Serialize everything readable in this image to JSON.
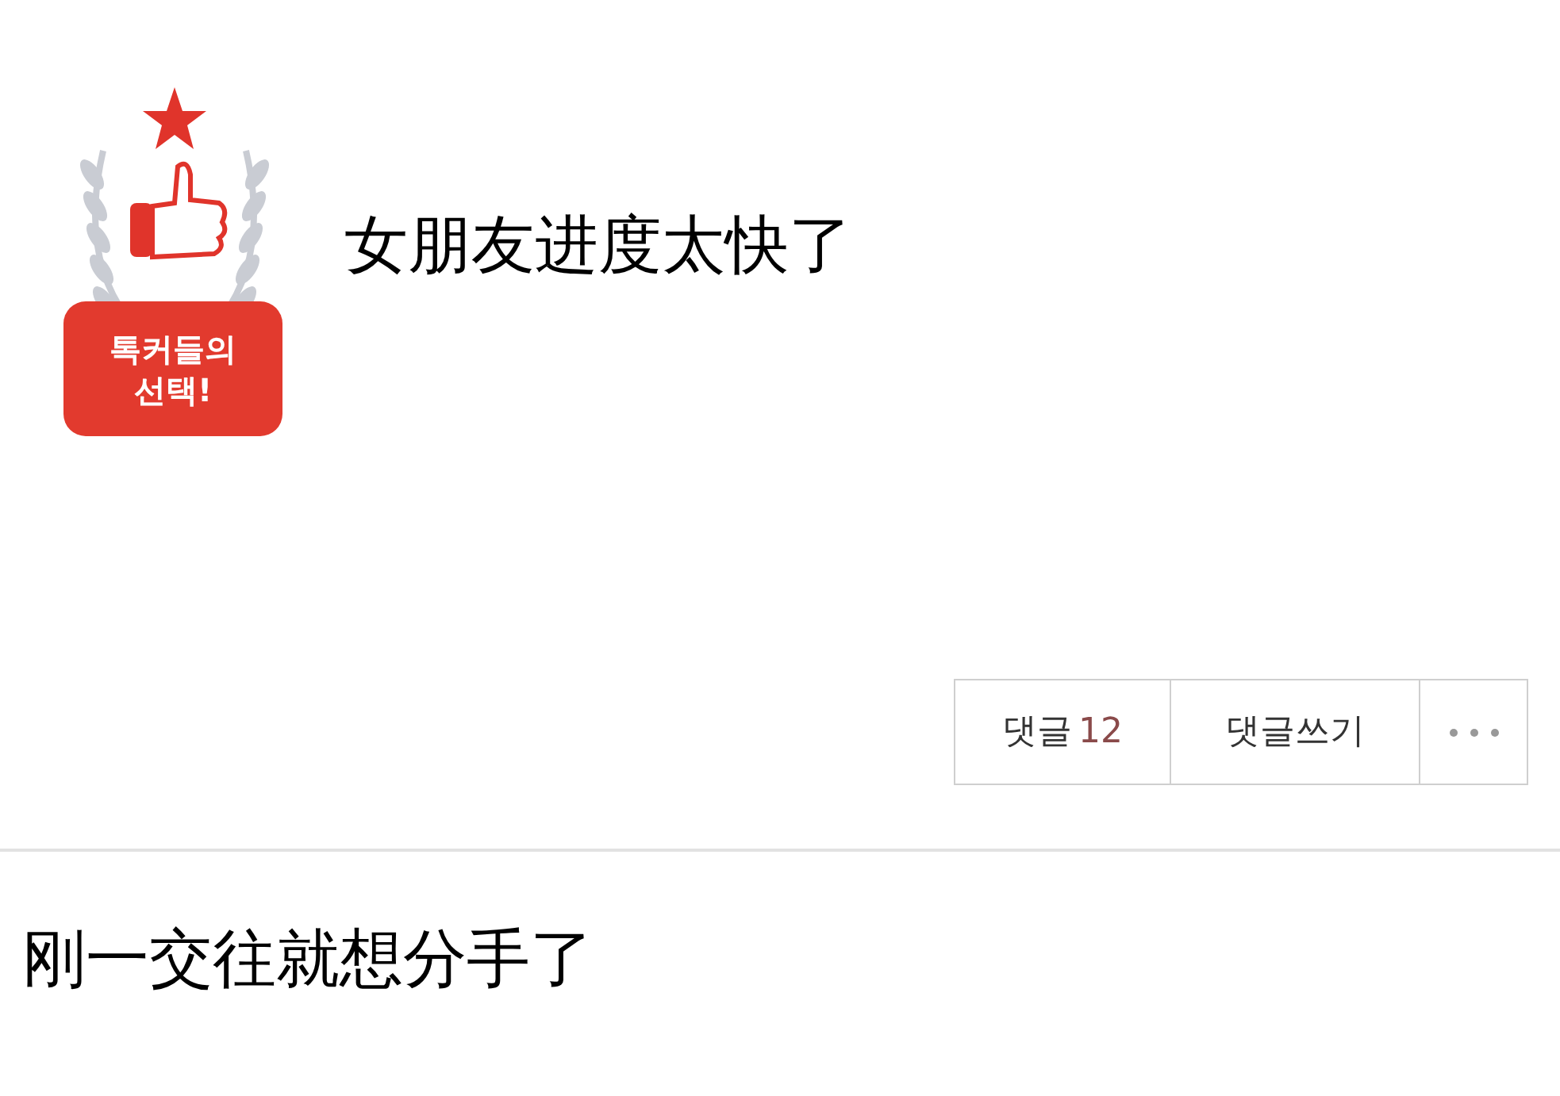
{
  "badge": {
    "line_1": "톡커들의",
    "line_2": "선택!"
  },
  "title": "女朋友进度太快了",
  "actions": {
    "comments": {
      "label": "댓글",
      "count": "12"
    },
    "write": "댓글쓰기"
  },
  "body": "刚一交往就想分手了"
}
